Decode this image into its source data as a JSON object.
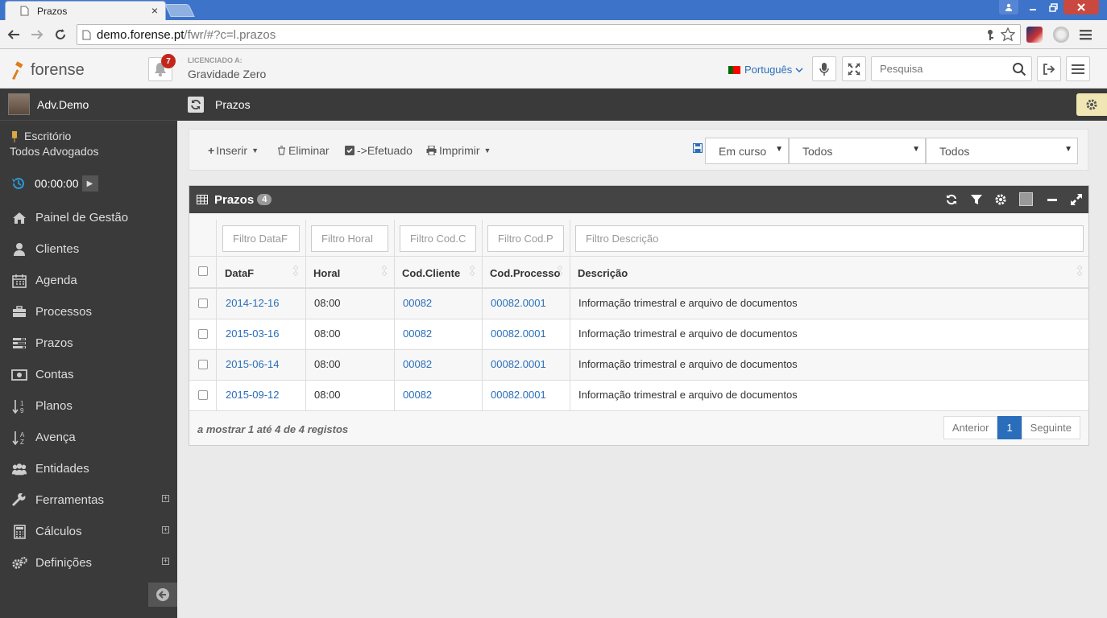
{
  "browser": {
    "tab_title": "Prazos",
    "tab_close": "×",
    "url_host": "demo.forense.pt",
    "url_path": "/fwr/#?c=l.prazos"
  },
  "header": {
    "logo_text": "forense",
    "notifications_count": "7",
    "licensed_label": "LICENCIADO A:",
    "licensed_name": "Gravidade Zero",
    "language": "Português",
    "search_placeholder": "Pesquisa"
  },
  "sidebar": {
    "user": "Adv.Demo",
    "office": "Escritório",
    "lawyers": "Todos Advogados",
    "timer": "00:00:00",
    "items": [
      {
        "label": "Painel de Gestão",
        "icon": "home-icon"
      },
      {
        "label": "Clientes",
        "icon": "user-icon"
      },
      {
        "label": "Agenda",
        "icon": "calendar-icon"
      },
      {
        "label": "Processos",
        "icon": "briefcase-icon"
      },
      {
        "label": "Prazos",
        "icon": "tasks-icon"
      },
      {
        "label": "Contas",
        "icon": "money-icon"
      },
      {
        "label": "Planos",
        "icon": "sort-numeric-icon"
      },
      {
        "label": "Avença",
        "icon": "sort-alpha-icon"
      },
      {
        "label": "Entidades",
        "icon": "users-icon"
      },
      {
        "label": "Ferramentas",
        "icon": "wrench-icon",
        "expandable": true
      },
      {
        "label": "Cálculos",
        "icon": "calculator-icon",
        "expandable": true
      },
      {
        "label": "Definições",
        "icon": "cogs-icon",
        "expandable": true
      }
    ]
  },
  "breadcrumb": {
    "title": "Prazos"
  },
  "actions": {
    "insert": "Inserir",
    "delete": "Eliminar",
    "done": "->Efetuado",
    "print": "Imprimir",
    "status_select": "Em curso",
    "filter_select_1": "Todos",
    "filter_select_2": "Todos"
  },
  "panel": {
    "title": "Prazos",
    "count": "4",
    "filters": [
      "Filtro DataF",
      "Filtro HoraI",
      "Filtro Cod.C",
      "Filtro Cod.P",
      "Filtro Descrição"
    ],
    "columns": [
      "DataF",
      "HoraI",
      "Cod.Cliente",
      "Cod.Processo",
      "Descrição"
    ],
    "rows": [
      {
        "date": "2014-12-16",
        "time": "08:00",
        "client": "00082",
        "process": "00082.0001",
        "desc": "Informação trimestral e arquivo de documentos"
      },
      {
        "date": "2015-03-16",
        "time": "08:00",
        "client": "00082",
        "process": "00082.0001",
        "desc": "Informação trimestral e arquivo de documentos"
      },
      {
        "date": "2015-06-14",
        "time": "08:00",
        "client": "00082",
        "process": "00082.0001",
        "desc": "Informação trimestral e arquivo de documentos"
      },
      {
        "date": "2015-09-12",
        "time": "08:00",
        "client": "00082",
        "process": "00082.0001",
        "desc": "Informação trimestral e arquivo de documentos"
      }
    ],
    "info": "a mostrar 1 até 4 de 4 registos",
    "prev": "Anterior",
    "page": "1",
    "next": "Seguinte"
  },
  "colors": {
    "accent": "#2a6ebb",
    "sidebar": "#3a3a3a",
    "badge": "#c3271b"
  }
}
